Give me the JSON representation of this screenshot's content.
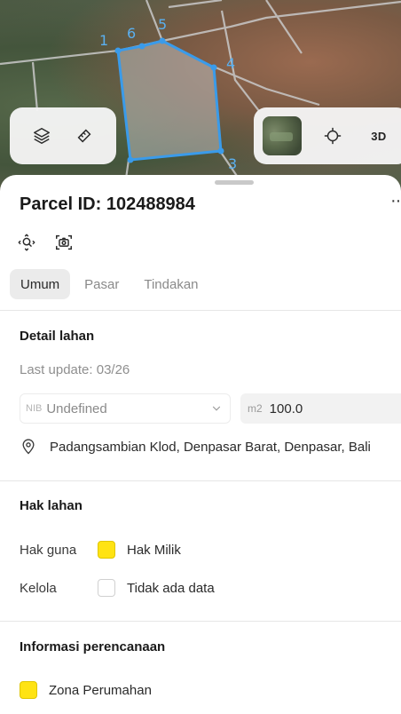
{
  "map": {
    "vertices": [
      "1",
      "6",
      "5",
      "4",
      "3"
    ],
    "controls": {
      "layers_icon": "layers-icon",
      "measure_icon": "ruler-icon",
      "basemap_icon": "basemap-thumbnail",
      "locate_icon": "crosshair-icon",
      "mode_3d_label": "3D"
    }
  },
  "parcel": {
    "title": "Parcel ID: 102488984",
    "more_label": "··"
  },
  "tabs": [
    {
      "label": "Umum",
      "active": true
    },
    {
      "label": "Pasar",
      "active": false
    },
    {
      "label": "Tindakan",
      "active": false
    }
  ],
  "detail": {
    "heading": "Detail lahan",
    "last_update": "Last update: 03/26",
    "nib_prefix": "NIB",
    "nib_value": "Undefined",
    "area_unit": "m2",
    "area_value": "100.0",
    "address": "Padangsambian Klod, Denpasar Barat, Denpasar, Bali"
  },
  "hak": {
    "heading": "Hak lahan",
    "rows": [
      {
        "label": "Hak guna",
        "value": "Hak Milik",
        "color": "#FFE313"
      },
      {
        "label": "Kelola",
        "value": "Tidak ada data",
        "color": "#FFFFFF"
      }
    ]
  },
  "planning": {
    "heading": "Informasi perencanaan",
    "zone": "Zona Perumahan",
    "zone_color": "#FFE313"
  },
  "colors": {
    "parcel_outline": "#3A9BEA",
    "accent_yellow": "#FFE313"
  }
}
